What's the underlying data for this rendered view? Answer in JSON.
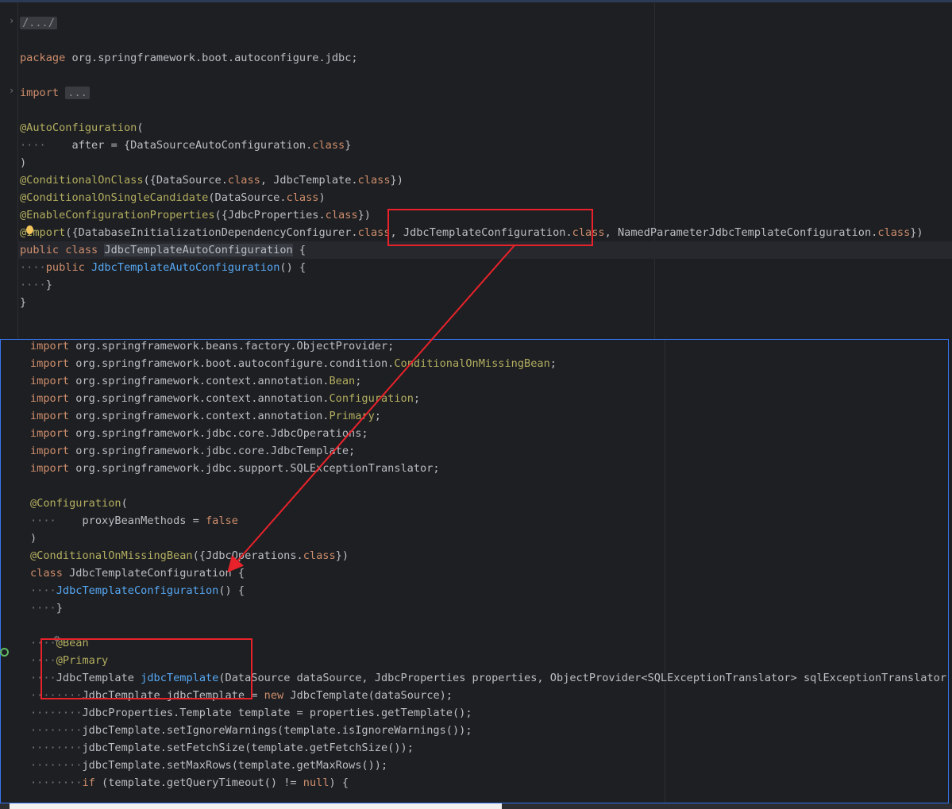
{
  "top_editor": {
    "lines": [
      {
        "parts": [
          [
            "fold",
            "/.../"
          ]
        ]
      },
      {
        "parts": []
      },
      {
        "parts": [
          [
            "kw",
            "package"
          ],
          [
            "cls",
            " org.springframework.boot.autoconfigure.jdbc;"
          ]
        ]
      },
      {
        "parts": []
      },
      {
        "parts": [
          [
            "kw",
            "import"
          ],
          [
            "cls",
            " "
          ],
          [
            "fold",
            "..."
          ]
        ]
      },
      {
        "parts": []
      },
      {
        "parts": [
          [
            "an",
            "@AutoConfiguration"
          ],
          [
            "cls",
            "("
          ]
        ]
      },
      {
        "parts": [
          [
            "dim",
            "····"
          ],
          [
            "cls",
            "    after = {DataSourceAutoConfiguration."
          ],
          [
            "kw",
            "class"
          ],
          [
            "cls",
            "}"
          ]
        ]
      },
      {
        "parts": [
          [
            "cls",
            ")"
          ]
        ]
      },
      {
        "parts": [
          [
            "an",
            "@ConditionalOnClass"
          ],
          [
            "cls",
            "({DataSource."
          ],
          [
            "kw",
            "class"
          ],
          [
            "cls",
            ", JdbcTemplate."
          ],
          [
            "kw",
            "class"
          ],
          [
            "cls",
            "})"
          ]
        ]
      },
      {
        "parts": [
          [
            "an",
            "@ConditionalOnSingleCandidate"
          ],
          [
            "cls",
            "(DataSource."
          ],
          [
            "kw",
            "class"
          ],
          [
            "cls",
            ")"
          ]
        ]
      },
      {
        "parts": [
          [
            "an",
            "@EnableConfigurationProperties"
          ],
          [
            "cls",
            "({JdbcProperties."
          ],
          [
            "kw",
            "class"
          ],
          [
            "cls",
            "})"
          ]
        ]
      },
      {
        "parts": [
          [
            "an",
            "@Import"
          ],
          [
            "cls",
            "({DatabaseInitializationDependencyConfigurer."
          ],
          [
            "kw",
            "class"
          ],
          [
            "cls",
            ", JdbcTemplateConfiguration."
          ],
          [
            "kw",
            "class"
          ],
          [
            "cls",
            ", NamedParameterJdbcTemplateConfiguration."
          ],
          [
            "kw",
            "class"
          ],
          [
            "cls",
            "})"
          ]
        ]
      },
      {
        "parts": [
          [
            "kw",
            "public class"
          ],
          [
            "cls",
            " "
          ],
          [
            "hl",
            "JdbcTemplateAutoConfiguration"
          ],
          [
            "cls",
            " {"
          ]
        ]
      },
      {
        "parts": [
          [
            "dim",
            "····"
          ],
          [
            "kw",
            "public"
          ],
          [
            "cls",
            " "
          ],
          [
            "fn",
            "JdbcTemplateAutoConfiguration"
          ],
          [
            "cls",
            "() {"
          ]
        ]
      },
      {
        "parts": [
          [
            "dim",
            "····"
          ],
          [
            "cls",
            "}"
          ]
        ]
      },
      {
        "parts": [
          [
            "cls",
            "}"
          ]
        ]
      }
    ]
  },
  "bottom_editor": {
    "lines": [
      {
        "parts": [
          [
            "kw",
            "import"
          ],
          [
            "cls",
            " org.springframework.beans.factory.ObjectProvider;"
          ]
        ]
      },
      {
        "parts": [
          [
            "kw",
            "import"
          ],
          [
            "cls",
            " org.springframework.boot.autoconfigure.condition."
          ],
          [
            "an",
            "ConditionalOnMissingBean"
          ],
          [
            "cls",
            ";"
          ]
        ]
      },
      {
        "parts": [
          [
            "kw",
            "import"
          ],
          [
            "cls",
            " org.springframework.context.annotation."
          ],
          [
            "an",
            "Bean"
          ],
          [
            "cls",
            ";"
          ]
        ]
      },
      {
        "parts": [
          [
            "kw",
            "import"
          ],
          [
            "cls",
            " org.springframework.context.annotation."
          ],
          [
            "an",
            "Configuration"
          ],
          [
            "cls",
            ";"
          ]
        ]
      },
      {
        "parts": [
          [
            "kw",
            "import"
          ],
          [
            "cls",
            " org.springframework.context.annotation."
          ],
          [
            "an",
            "Primary"
          ],
          [
            "cls",
            ";"
          ]
        ]
      },
      {
        "parts": [
          [
            "kw",
            "import"
          ],
          [
            "cls",
            " org.springframework.jdbc.core.JdbcOperations;"
          ]
        ]
      },
      {
        "parts": [
          [
            "kw",
            "import"
          ],
          [
            "cls",
            " org.springframework.jdbc.core.JdbcTemplate;"
          ]
        ]
      },
      {
        "parts": [
          [
            "kw",
            "import"
          ],
          [
            "cls",
            " org.springframework.jdbc.support.SQLExceptionTranslator;"
          ]
        ]
      },
      {
        "parts": []
      },
      {
        "parts": [
          [
            "an",
            "@Configuration"
          ],
          [
            "cls",
            "("
          ]
        ]
      },
      {
        "parts": [
          [
            "dim",
            "····"
          ],
          [
            "cls",
            "    proxyBeanMethods = "
          ],
          [
            "kw",
            "false"
          ]
        ]
      },
      {
        "parts": [
          [
            "cls",
            ")"
          ]
        ]
      },
      {
        "parts": [
          [
            "an",
            "@ConditionalOnMissingBean"
          ],
          [
            "cls",
            "({JdbcOperations."
          ],
          [
            "kw",
            "class"
          ],
          [
            "cls",
            "})"
          ]
        ]
      },
      {
        "parts": [
          [
            "kw",
            "class"
          ],
          [
            "cls",
            " JdbcTemplateConfiguration {"
          ]
        ]
      },
      {
        "parts": [
          [
            "dim",
            "····"
          ],
          [
            "fn",
            "JdbcTemplateConfiguration"
          ],
          [
            "cls",
            "() {"
          ]
        ]
      },
      {
        "parts": [
          [
            "dim",
            "····"
          ],
          [
            "cls",
            "}"
          ]
        ]
      },
      {
        "parts": []
      },
      {
        "parts": [
          [
            "dim",
            "····"
          ],
          [
            "an",
            "@Bean"
          ]
        ]
      },
      {
        "parts": [
          [
            "dim",
            "····"
          ],
          [
            "an",
            "@Primary"
          ]
        ]
      },
      {
        "parts": [
          [
            "dim",
            "····"
          ],
          [
            "cls",
            "JdbcTemplate "
          ],
          [
            "fn",
            "jdbcTemplate"
          ],
          [
            "cls",
            "(DataSource dataSource, JdbcProperties properties, ObjectProvider<SQLExceptionTranslator> sqlExceptionTranslator) {"
          ]
        ]
      },
      {
        "parts": [
          [
            "dim",
            "········"
          ],
          [
            "cls",
            "JdbcTemplate jdbcTemplate = "
          ],
          [
            "kw",
            "new"
          ],
          [
            "cls",
            " JdbcTemplate(dataSource);"
          ]
        ]
      },
      {
        "parts": [
          [
            "dim",
            "········"
          ],
          [
            "cls",
            "JdbcProperties.Template template = properties.getTemplate();"
          ]
        ]
      },
      {
        "parts": [
          [
            "dim",
            "········"
          ],
          [
            "cls",
            "jdbcTemplate.setIgnoreWarnings(template.isIgnoreWarnings());"
          ]
        ]
      },
      {
        "parts": [
          [
            "dim",
            "········"
          ],
          [
            "cls",
            "jdbcTemplate.setFetchSize(template.getFetchSize());"
          ]
        ]
      },
      {
        "parts": [
          [
            "dim",
            "········"
          ],
          [
            "cls",
            "jdbcTemplate.setMaxRows(template.getMaxRows());"
          ]
        ]
      },
      {
        "parts": [
          [
            "dim",
            "········"
          ],
          [
            "kw",
            "if"
          ],
          [
            "cls",
            " (template.getQueryTimeout() != "
          ],
          [
            "kw",
            "null"
          ],
          [
            "cls",
            ") {"
          ]
        ]
      }
    ]
  },
  "colors": {
    "annotation": "#b3ae60",
    "keyword": "#cf8e6d",
    "function": "#56a8f5",
    "highlight_box": "#e8222a",
    "focus_border": "#3574f0"
  }
}
